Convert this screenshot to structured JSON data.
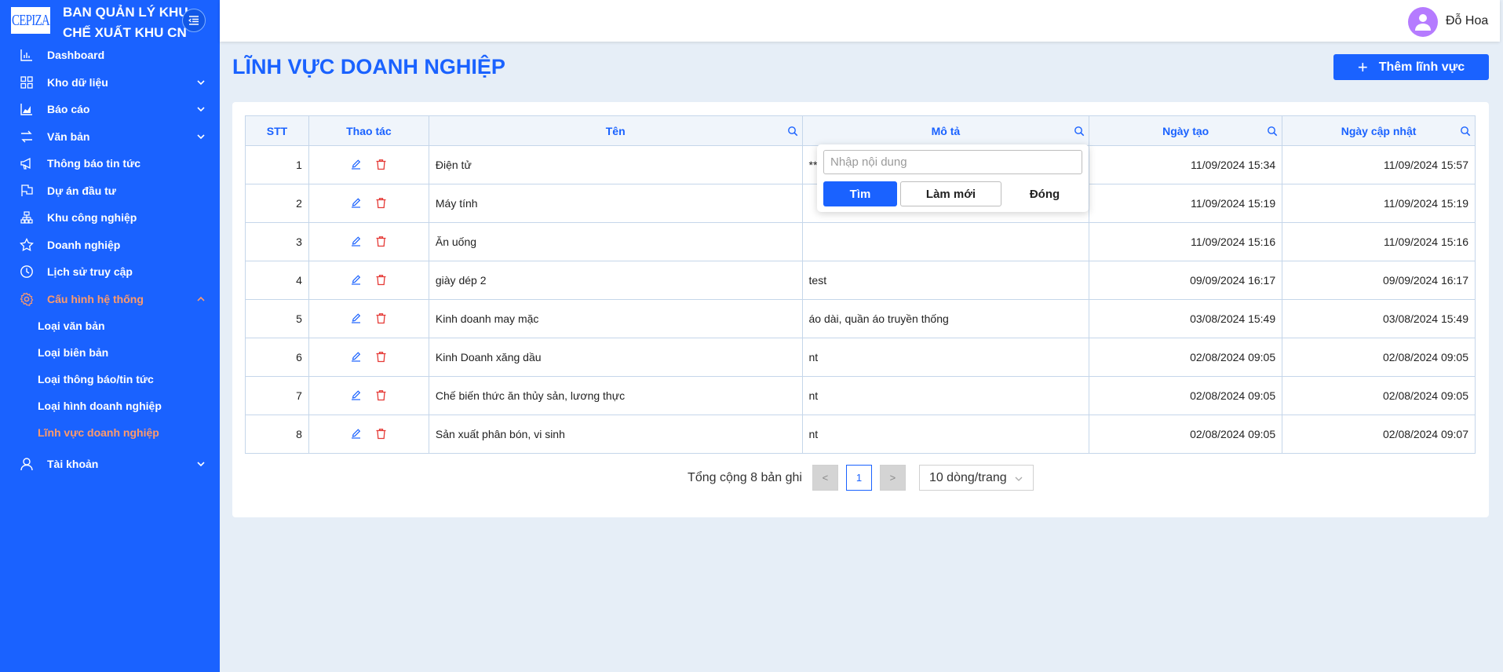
{
  "brand": {
    "logo_text": "CEPIZA",
    "title_line1": "BAN QUẢN LÝ KHU",
    "title_line2": "CHẾ XUẤT KHU CN"
  },
  "sidebar": {
    "items": [
      {
        "label": "Dashboard",
        "icon": "bar-chart-icon"
      },
      {
        "label": "Kho dữ liệu",
        "icon": "grid-icon",
        "expandable": true
      },
      {
        "label": "Báo cáo",
        "icon": "area-chart-icon",
        "expandable": true
      },
      {
        "label": "Văn bản",
        "icon": "transfer-icon",
        "expandable": true
      },
      {
        "label": "Thông báo tin tức",
        "icon": "megaphone-icon"
      },
      {
        "label": "Dự án đầu tư",
        "icon": "flag-icon"
      },
      {
        "label": "Khu công nghiệp",
        "icon": "cluster-icon"
      },
      {
        "label": "Doanh nghiệp",
        "icon": "star-icon"
      },
      {
        "label": "Lịch sử truy cập",
        "icon": "history-icon"
      },
      {
        "label": "Cấu hình hệ thống",
        "icon": "gear-icon",
        "expanded": true,
        "active": true
      }
    ],
    "submenu": [
      {
        "label": "Loại văn bản"
      },
      {
        "label": "Loại biên bản"
      },
      {
        "label": "Loại thông báo/tin tức"
      },
      {
        "label": "Loại hình doanh nghiệp"
      },
      {
        "label": "Lĩnh vực doanh nghiệp",
        "active": true
      }
    ],
    "account": {
      "label": "Tài khoản",
      "icon": "user-icon"
    }
  },
  "header": {
    "user_name": "Đỗ Hoa"
  },
  "page": {
    "title": "LĨNH VỰC DOANH NGHIỆP",
    "add_button": "Thêm lĩnh vực"
  },
  "table": {
    "columns": [
      "STT",
      "Thao tác",
      "Tên",
      "Mô tả",
      "Ngày tạo",
      "Ngày cập nhật"
    ],
    "rows": [
      {
        "stt": "1",
        "ten": "Điện tử",
        "mo_ta": "**",
        "ngay_tao": "11/09/2024 15:34",
        "ngay_cap_nhat": "11/09/2024 15:57"
      },
      {
        "stt": "2",
        "ten": "Máy tính",
        "mo_ta": "",
        "ngay_tao": "11/09/2024 15:19",
        "ngay_cap_nhat": "11/09/2024 15:19"
      },
      {
        "stt": "3",
        "ten": "Ăn uống",
        "mo_ta": "",
        "ngay_tao": "11/09/2024 15:16",
        "ngay_cap_nhat": "11/09/2024 15:16"
      },
      {
        "stt": "4",
        "ten": "giày dép 2",
        "mo_ta": "test",
        "ngay_tao": "09/09/2024 16:17",
        "ngay_cap_nhat": "09/09/2024 16:17"
      },
      {
        "stt": "5",
        "ten": "Kinh doanh may mặc",
        "mo_ta": "áo dài, quần áo truyền thống",
        "ngay_tao": "03/08/2024 15:49",
        "ngay_cap_nhat": "03/08/2024 15:49"
      },
      {
        "stt": "6",
        "ten": "Kinh Doanh xăng dầu",
        "mo_ta": "nt",
        "ngay_tao": "02/08/2024 09:05",
        "ngay_cap_nhat": "02/08/2024 09:05"
      },
      {
        "stt": "7",
        "ten": "Chế biến thức ăn thủy sản, lương thực",
        "mo_ta": "nt",
        "ngay_tao": "02/08/2024 09:05",
        "ngay_cap_nhat": "02/08/2024 09:05"
      },
      {
        "stt": "8",
        "ten": "Sản xuất phân bón, vi sinh",
        "mo_ta": "nt",
        "ngay_tao": "02/08/2024 09:05",
        "ngay_cap_nhat": "02/08/2024 09:07"
      }
    ]
  },
  "pagination": {
    "total_text": "Tổng cộng 8 bản ghi",
    "prev": "<",
    "current": "1",
    "next": ">",
    "page_size": "10 dòng/trang"
  },
  "search_popup": {
    "placeholder": "Nhập nội dung",
    "value": "",
    "find": "Tìm",
    "reset": "Làm mới",
    "close": "Đóng"
  },
  "colors": {
    "primary": "#1a62ff",
    "active_menu": "#ff9a6b",
    "delete": "#e53935",
    "background": "#e6eef7"
  }
}
